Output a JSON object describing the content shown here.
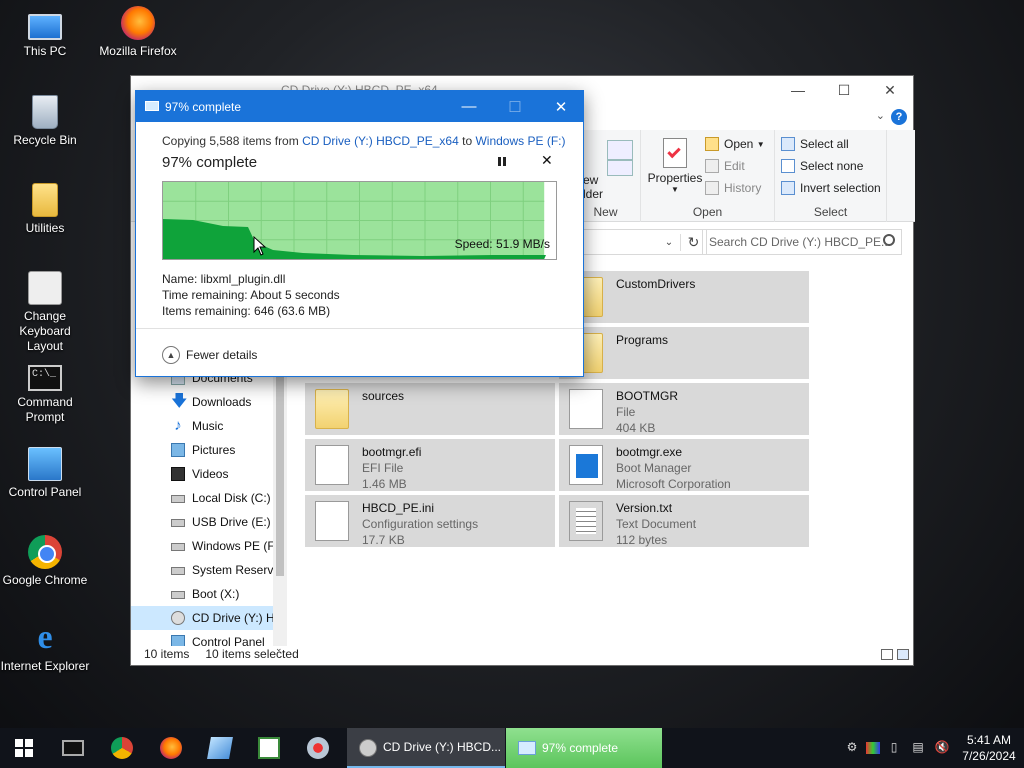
{
  "desktop": {
    "icons": [
      {
        "label": "This PC"
      },
      {
        "label": "Mozilla Firefox"
      },
      {
        "label": "Recycle Bin"
      },
      {
        "label": "Utilities"
      },
      {
        "label": "Change Keyboard Layout"
      },
      {
        "label": "Command Prompt"
      },
      {
        "label": "Control Panel"
      },
      {
        "label": "Google Chrome"
      },
      {
        "label": "Internet Explorer"
      }
    ]
  },
  "explorer": {
    "title": "CD Drive (Y:) HBCD_PE_x64",
    "ribbon": {
      "new_group": {
        "partial_1": "ew",
        "partial_2": "lder",
        "label": "New"
      },
      "open_group": {
        "properties": "Properties",
        "open": "Open",
        "edit": "Edit",
        "history": "History",
        "label": "Open"
      },
      "select_group": {
        "select_all": "Select all",
        "select_none": "Select none",
        "invert": "Invert selection",
        "label": "Select"
      }
    },
    "search_placeholder": "Search CD Drive (Y:) HBCD_PE...",
    "nav_items": [
      {
        "label": "Documents"
      },
      {
        "label": "Downloads"
      },
      {
        "label": "Music"
      },
      {
        "label": "Pictures"
      },
      {
        "label": "Videos"
      },
      {
        "label": "Local Disk (C:)"
      },
      {
        "label": "USB Drive (E:)"
      },
      {
        "label": "Windows PE (F"
      },
      {
        "label": "System Reserve"
      },
      {
        "label": "Boot (X:)"
      },
      {
        "label": "CD Drive (Y:) H"
      },
      {
        "label": "Control Panel"
      }
    ],
    "files": [
      {
        "name": "CustomDrivers",
        "line2": "",
        "line3": ""
      },
      {
        "name": "Programs",
        "line2": "",
        "line3": ""
      },
      {
        "name": "sources",
        "line2": "",
        "line3": ""
      },
      {
        "name": "BOOTMGR",
        "line2": "File",
        "line3": "404 KB"
      },
      {
        "name": "bootmgr.efi",
        "line2": "EFI File",
        "line3": "1.46 MB"
      },
      {
        "name": "bootmgr.exe",
        "line2": "Boot Manager",
        "line3": "Microsoft Corporation"
      },
      {
        "name": "HBCD_PE.ini",
        "line2": "Configuration settings",
        "line3": "17.7 KB"
      },
      {
        "name": "Version.txt",
        "line2": "Text Document",
        "line3": "112 bytes"
      }
    ],
    "status": {
      "items": "10 items",
      "selected": "10 items selected"
    }
  },
  "copy_dialog": {
    "title": "97% complete",
    "copy_prefix": "Copying 5,588 items from ",
    "source": "CD Drive (Y:) HBCD_PE_x64",
    "to": " to ",
    "destination": "Windows PE (F:)",
    "percent_label": "97% complete",
    "progress": 0.97,
    "speed": "Speed: 51.9 MB/s",
    "name_line": "Name:  libxml_plugin.dll",
    "time_line": "Time remaining:  About 5 seconds",
    "items_line": "Items remaining:  646 (63.6 MB)",
    "fewer_details": "Fewer details",
    "colors": {
      "fill_light": "#9be39b",
      "fill_dark": "#0fa33a",
      "title_bar": "#1a73d9"
    }
  },
  "taskbar": {
    "pinned": [
      "cmd-icon",
      "chrome-icon",
      "firefox-icon",
      "notepad-icon",
      "spreadsheet-icon",
      "tool-icon"
    ],
    "tasks": [
      {
        "label": "CD Drive (Y:) HBCD..."
      },
      {
        "label": "97% complete"
      }
    ],
    "clock": {
      "time": "5:41 AM",
      "date": "7/26/2024"
    }
  }
}
